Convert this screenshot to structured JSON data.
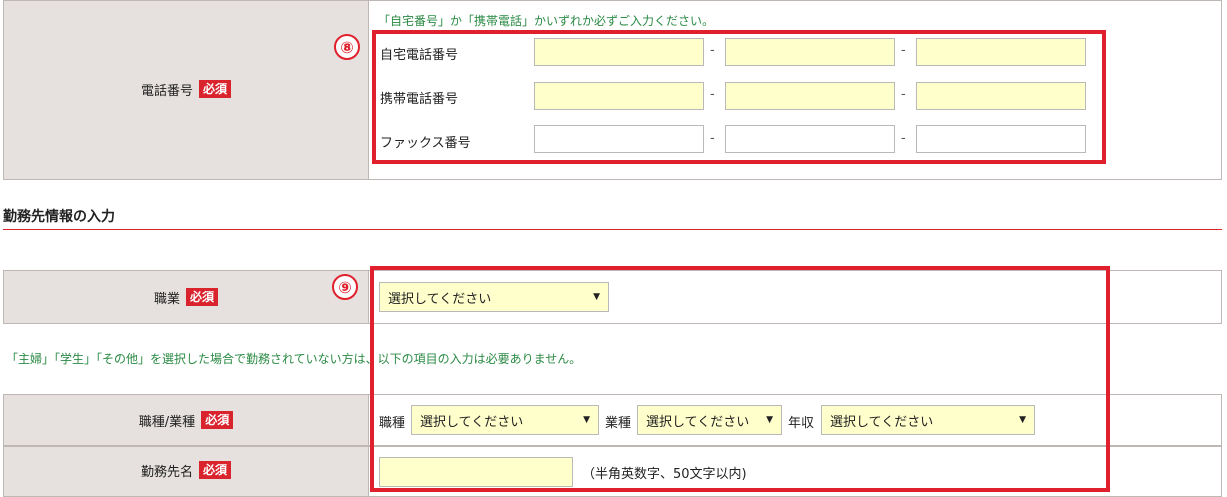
{
  "phone": {
    "note": "「自宅番号」か「携帯電話」かいずれか必ずご入力ください。",
    "label": "電話番号",
    "required_badge": "必須",
    "marker": "⑧",
    "rows": [
      {
        "label": "自宅電話番号",
        "sep": "-"
      },
      {
        "label": "携帯電話番号",
        "sep": "-"
      },
      {
        "label": "ファックス番号",
        "sep": "-"
      }
    ]
  },
  "work_section": {
    "title": "勤務先情報の入力",
    "marker": "⑨",
    "occupation": {
      "label": "職業",
      "required_badge": "必須",
      "select_value": "選択してください"
    },
    "note": "「主婦」「学生」「その他」を選択した場合で勤務されていない方は、以下の項目の入力は必要ありません。",
    "job": {
      "label": "職種/業種",
      "required_badge": "必須",
      "job_type_label": "職種",
      "job_type_value": "選択してください",
      "industry_label": "業種",
      "industry_value": "選択してください",
      "income_label": "年収",
      "income_value": "選択してください"
    },
    "company": {
      "label": "勤務先名",
      "required_badge": "必須",
      "hint": "（半角英数字、50文字以内)"
    }
  },
  "colors": {
    "accent_red": "#e0202c",
    "required_bg": "#d9232d",
    "label_bg": "#e6e1df",
    "input_bg": "#ffffcc",
    "note_green": "#2a8a44"
  }
}
